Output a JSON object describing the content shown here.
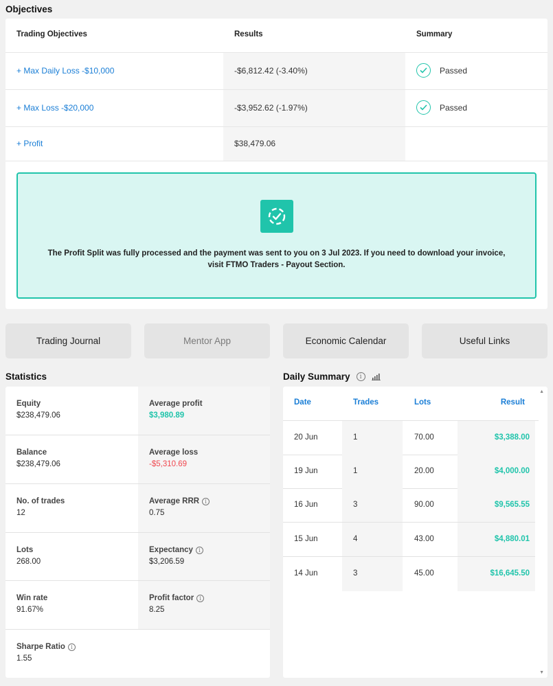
{
  "objectives": {
    "title": "Objectives",
    "headers": {
      "objective": "Trading Objectives",
      "results": "Results",
      "summary": "Summary"
    },
    "rows": [
      {
        "name": "+ Max Daily Loss -$10,000",
        "result": "-$6,812.42 (-3.40%)",
        "summary": "Passed",
        "icon": "check-circle-icon"
      },
      {
        "name": "+ Max Loss -$20,000",
        "result": "-$3,952.62 (-1.97%)",
        "summary": "Passed",
        "icon": "check-circle-icon"
      },
      {
        "name": "+ Profit",
        "result": "$38,479.06",
        "summary": ""
      }
    ],
    "notice": {
      "icon": "dashed-check-icon",
      "line1": "The Profit Split was fully processed and the payment was sent to you on 3 Jul 2023. If you need to download your invoice,",
      "line2": "visit FTMO Traders - Payout Section."
    }
  },
  "tabs": [
    "Trading Journal",
    "Mentor App",
    "Economic Calendar",
    "Useful Links"
  ],
  "statistics": {
    "title": "Statistics",
    "equity_label": "Equity",
    "equity": "$238,479.06",
    "avg_profit_label": "Average profit",
    "avg_profit": "$3,980.89",
    "balance_label": "Balance",
    "balance": "$238,479.06",
    "avg_loss_label": "Average loss",
    "avg_loss": "-$5,310.69",
    "trades_label": "No. of trades",
    "trades": "12",
    "rrr_label": "Average RRR",
    "rrr": "0.75",
    "lots_label": "Lots",
    "lots": "268.00",
    "expectancy_label": "Expectancy",
    "expectancy": "$3,206.59",
    "winrate_label": "Win rate",
    "winrate": "91.67%",
    "pf_label": "Profit factor",
    "pf": "8.25",
    "sharpe_label": "Sharpe Ratio",
    "sharpe": "1.55"
  },
  "daily_summary": {
    "title": "Daily Summary",
    "headers": {
      "date": "Date",
      "trades": "Trades",
      "lots": "Lots",
      "result": "Result"
    },
    "rows": [
      {
        "date": "20 Jun",
        "trades": "1",
        "lots": "70.00",
        "result": "$3,388.00"
      },
      {
        "date": "19 Jun",
        "trades": "1",
        "lots": "20.00",
        "result": "$4,000.00"
      },
      {
        "date": "16 Jun",
        "trades": "3",
        "lots": "90.00",
        "result": "$9,565.55"
      },
      {
        "date": "15 Jun",
        "trades": "4",
        "lots": "43.00",
        "result": "$4,880.01"
      },
      {
        "date": "14 Jun",
        "trades": "3",
        "lots": "45.00",
        "result": "$16,645.50"
      }
    ]
  },
  "colors": {
    "accent": "#20c4ab",
    "link": "#1a7ed6",
    "negative": "#f0474f"
  }
}
